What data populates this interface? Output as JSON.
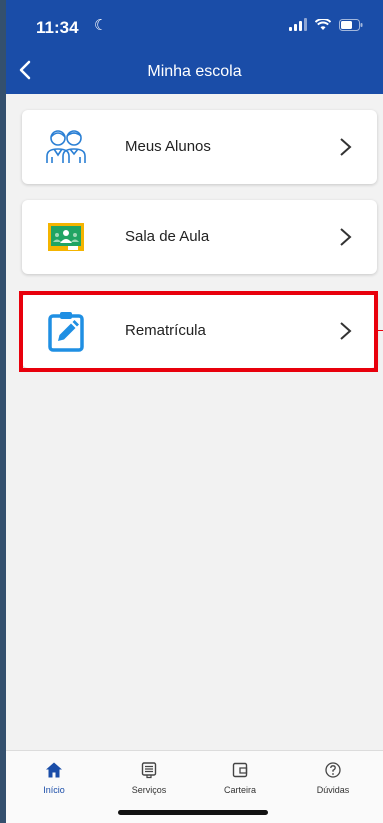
{
  "status_bar": {
    "time": "11:34"
  },
  "header": {
    "title": "Minha escola"
  },
  "menu_items": [
    {
      "label": "Meus Alunos",
      "icon": "students-icon"
    },
    {
      "label": "Sala de Aula",
      "icon": "classroom-icon"
    },
    {
      "label": "Rematrícula",
      "icon": "edit-clipboard-icon",
      "highlighted": true
    }
  ],
  "tabbar": {
    "tabs": [
      {
        "label": "Início",
        "icon": "home-icon",
        "active": true
      },
      {
        "label": "Serviços",
        "icon": "services-icon",
        "active": false
      },
      {
        "label": "Carteira",
        "icon": "wallet-icon",
        "active": false
      },
      {
        "label": "Dúvidas",
        "icon": "help-icon",
        "active": false
      }
    ]
  },
  "colors": {
    "primary": "#1a4da8",
    "highlight": "#e8000c",
    "background": "#f2f2f2"
  }
}
